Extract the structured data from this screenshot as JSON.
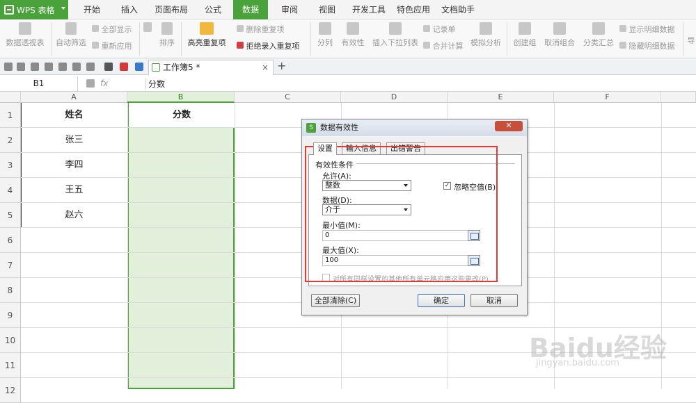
{
  "app": {
    "name": "WPS 表格"
  },
  "menu": [
    "开始",
    "插入",
    "页面布局",
    "公式",
    "数据",
    "审阅",
    "视图",
    "开发工具",
    "特色应用",
    "文档助手"
  ],
  "menu_active": "数据",
  "ribbon": {
    "pivot": "数据透视表",
    "autofilter": "自动筛选",
    "show_all": "全部显示",
    "reapply": "重新应用",
    "sort": "排序",
    "highlight_dup": "高亮重复项",
    "delete_dup": "删除重复项",
    "reject_dup": "拒绝录入重复项",
    "split": "分列",
    "validity": "有效性",
    "insert_dropdown": "插入下拉列表",
    "record_form": "记录单",
    "consolidate": "合并计算",
    "simulation": "模拟分析",
    "group": "创建组",
    "ungroup": "取消组合",
    "subtotal": "分类汇总",
    "show_detail": "显示明细数据",
    "hide_detail": "隐藏明细数据",
    "import": "导"
  },
  "doc_tab": {
    "title": "工作簿5 *"
  },
  "formula_bar": {
    "cell_ref": "B1",
    "fx": "fx",
    "value": "分数"
  },
  "columns": [
    "A",
    "B",
    "C",
    "D",
    "E",
    "F"
  ],
  "rows": [
    "1",
    "2",
    "3",
    "4",
    "5",
    "6",
    "7",
    "8",
    "9",
    "10",
    "11",
    "12"
  ],
  "cells": {
    "A1": "姓名",
    "B1": "分数",
    "A2": "张三",
    "A3": "李四",
    "A4": "王五",
    "A5": "赵六"
  },
  "dialog": {
    "title": "数据有效性",
    "close": "✕",
    "tabs": [
      "设置",
      "输入信息",
      "出错警告"
    ],
    "group_title": "有效性条件",
    "allow_label": "允许(A):",
    "allow_value": "整数",
    "ignore_blank_label": "忽略空值(B)",
    "ignore_blank_checked": "✓",
    "data_label": "数据(D):",
    "data_value": "介于",
    "min_label": "最小值(M):",
    "min_value": "0",
    "max_label": "最大值(X):",
    "max_value": "100",
    "apply_all_label": "对所有同样设置的其他所有单元格应用这些更改(P)",
    "clear_all": "全部清除(C)",
    "ok": "确定",
    "cancel": "取消"
  },
  "watermark": {
    "brand": "Baidu经验",
    "url": "jingyan.baidu.com"
  },
  "colors": {
    "accent_green": "#4aa23a",
    "selection_fill": "#e2f0db",
    "annotation_red": "#e03a3a"
  }
}
